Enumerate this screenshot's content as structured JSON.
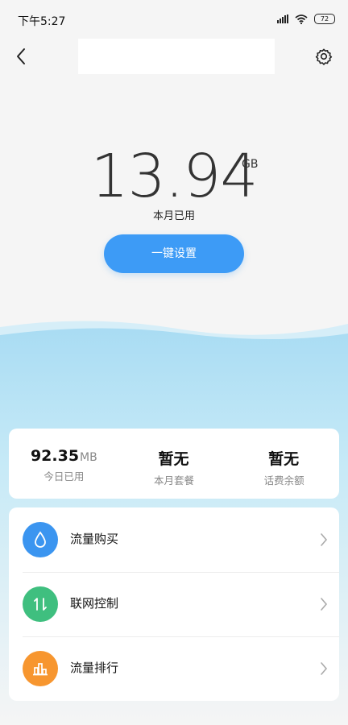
{
  "status_bar": {
    "time": "下午5:27",
    "battery": "72"
  },
  "header": {
    "title": ""
  },
  "usage": {
    "value": "13.94",
    "unit": "GB",
    "label": "本月已用"
  },
  "setup_button": {
    "label": "一键设置"
  },
  "stats": [
    {
      "value": "92.35",
      "unit": "MB",
      "label": "今日已用"
    },
    {
      "value": "暂无",
      "unit": "",
      "label": "本月套餐"
    },
    {
      "value": "暂无",
      "unit": "",
      "label": "话费余额"
    }
  ],
  "menu": [
    {
      "label": "流量购买",
      "icon": "water-drop-icon",
      "color": "#3b95f0"
    },
    {
      "label": "联网控制",
      "icon": "up-down-arrows-icon",
      "color": "#3fbf7f"
    },
    {
      "label": "流量排行",
      "icon": "bar-chart-icon",
      "color": "#f7962f"
    }
  ],
  "colors": {
    "accent": "#3d9bf6",
    "wave": "#b3e3f5"
  }
}
